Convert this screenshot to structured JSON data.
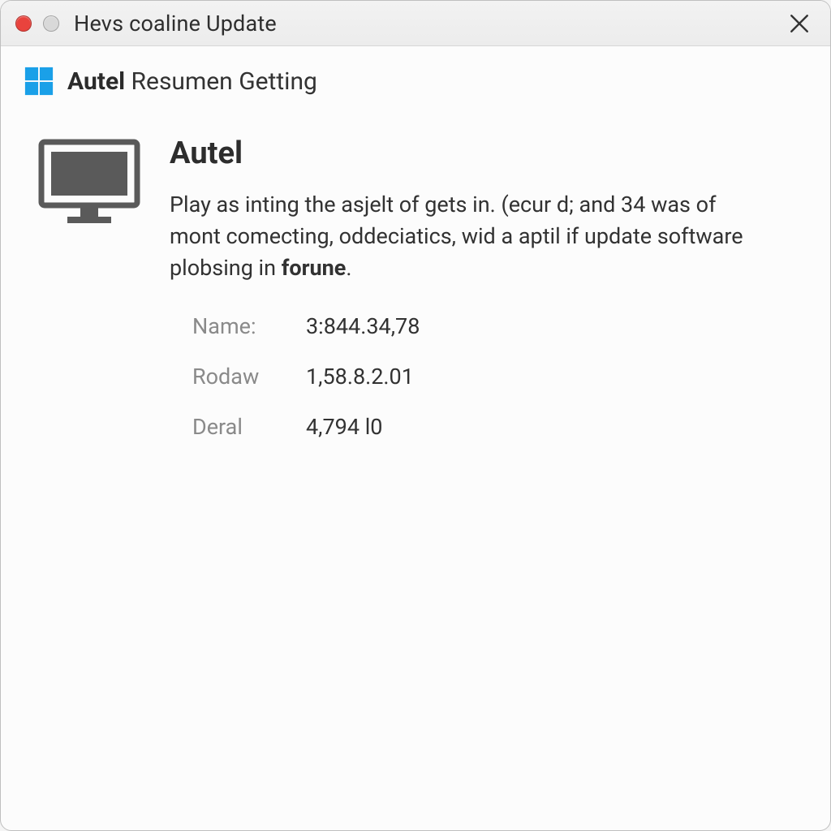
{
  "titlebar": {
    "title": "Hevs coaline Update"
  },
  "subheader": {
    "bold": "Autel",
    "rest": "Resumen Getting"
  },
  "main": {
    "heading": "Autel",
    "description_pre": "Play as inting the asjelt of gets in. (ecur d; and 34 was of mont comecting, oddeciatics, wid a aptil if update software plobsing in ",
    "description_bold": "forune",
    "description_post": ".",
    "rows": [
      {
        "label": "Name:",
        "value": "3:844.34,78"
      },
      {
        "label": "Rodaw",
        "value": "1,58.8.2.01"
      },
      {
        "label": "Deral",
        "value": "4,794 l0"
      }
    ]
  }
}
